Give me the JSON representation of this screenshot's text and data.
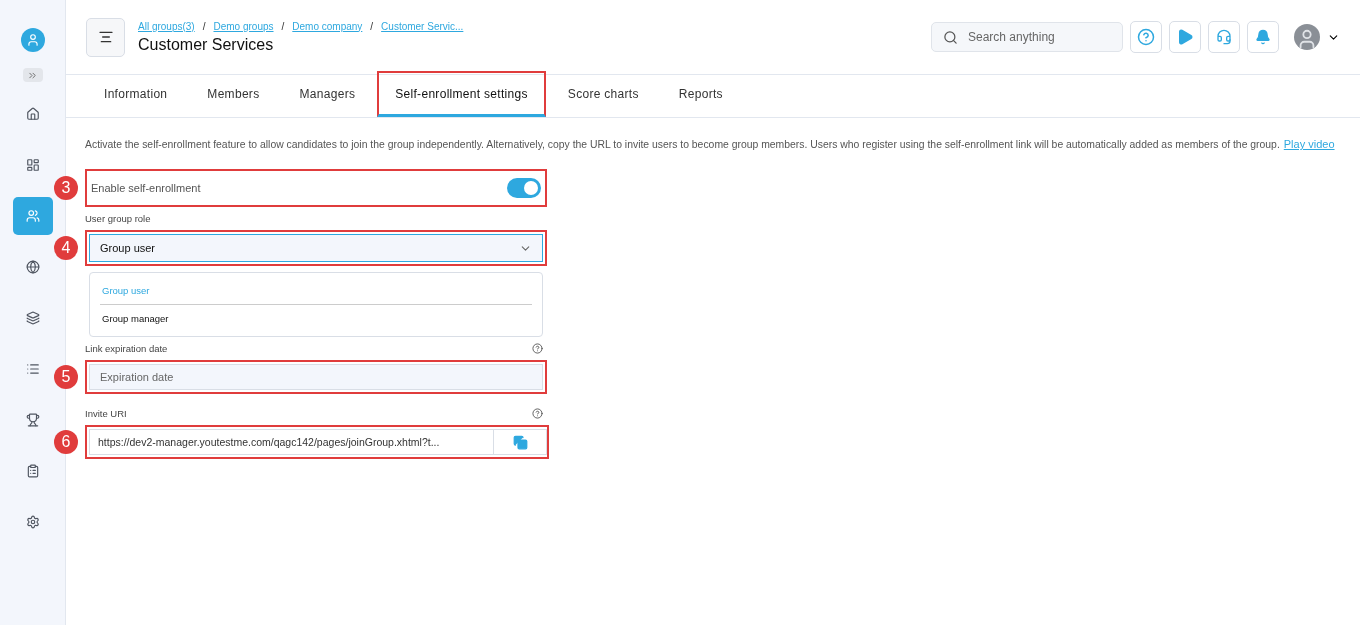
{
  "sidebar": {
    "items": [
      {
        "selected": false
      },
      {
        "selected": false
      },
      {
        "selected": true
      },
      {
        "selected": false
      },
      {
        "selected": false
      },
      {
        "selected": false
      },
      {
        "selected": false
      },
      {
        "selected": false
      },
      {
        "selected": false
      }
    ]
  },
  "breadcrumbs": [
    {
      "label": "All groups(3)"
    },
    {
      "separator": "/",
      "label": "Demo groups"
    },
    {
      "separator": "/",
      "label": "Demo company"
    },
    {
      "separator": "/",
      "label": "Customer Servic..."
    }
  ],
  "page_title": "Customer Services",
  "search": {
    "placeholder": "Search anything"
  },
  "tabs": [
    {
      "label": "Information",
      "selected": false,
      "highlighted": false
    },
    {
      "label": "Members",
      "selected": false,
      "highlighted": false
    },
    {
      "label": "Managers",
      "selected": false,
      "highlighted": false
    },
    {
      "label": "Self-enrollment settings",
      "selected": true,
      "highlighted": true
    },
    {
      "label": "Score charts",
      "selected": false,
      "highlighted": false
    },
    {
      "label": "Reports",
      "selected": false,
      "highlighted": false
    }
  ],
  "description": "Activate the self-enrollment feature to allow candidates to join the group independently. Alternatively, copy the URL to invite users to become group members. Users who register using the self-enrollment link will be automatically added as members of the group.",
  "description_link": "Play video",
  "enable_toggle": {
    "label": "Enable self-enrollment",
    "on": true,
    "callout": "3"
  },
  "role": {
    "label": "User group role",
    "value": "Group user",
    "callout": "4",
    "expanded": true,
    "options": [
      {
        "label": "Group user",
        "selected": true
      },
      {
        "label": "Group manager",
        "selected": false
      }
    ]
  },
  "expiration": {
    "label": "Link expiration date",
    "placeholder": "Expiration date",
    "callout": "5"
  },
  "invite": {
    "label": "Invite URI",
    "value": "https://dev2-manager.youtestme.com/qagc142/pages/joinGroup.xhtml?t...",
    "callout": "6"
  }
}
